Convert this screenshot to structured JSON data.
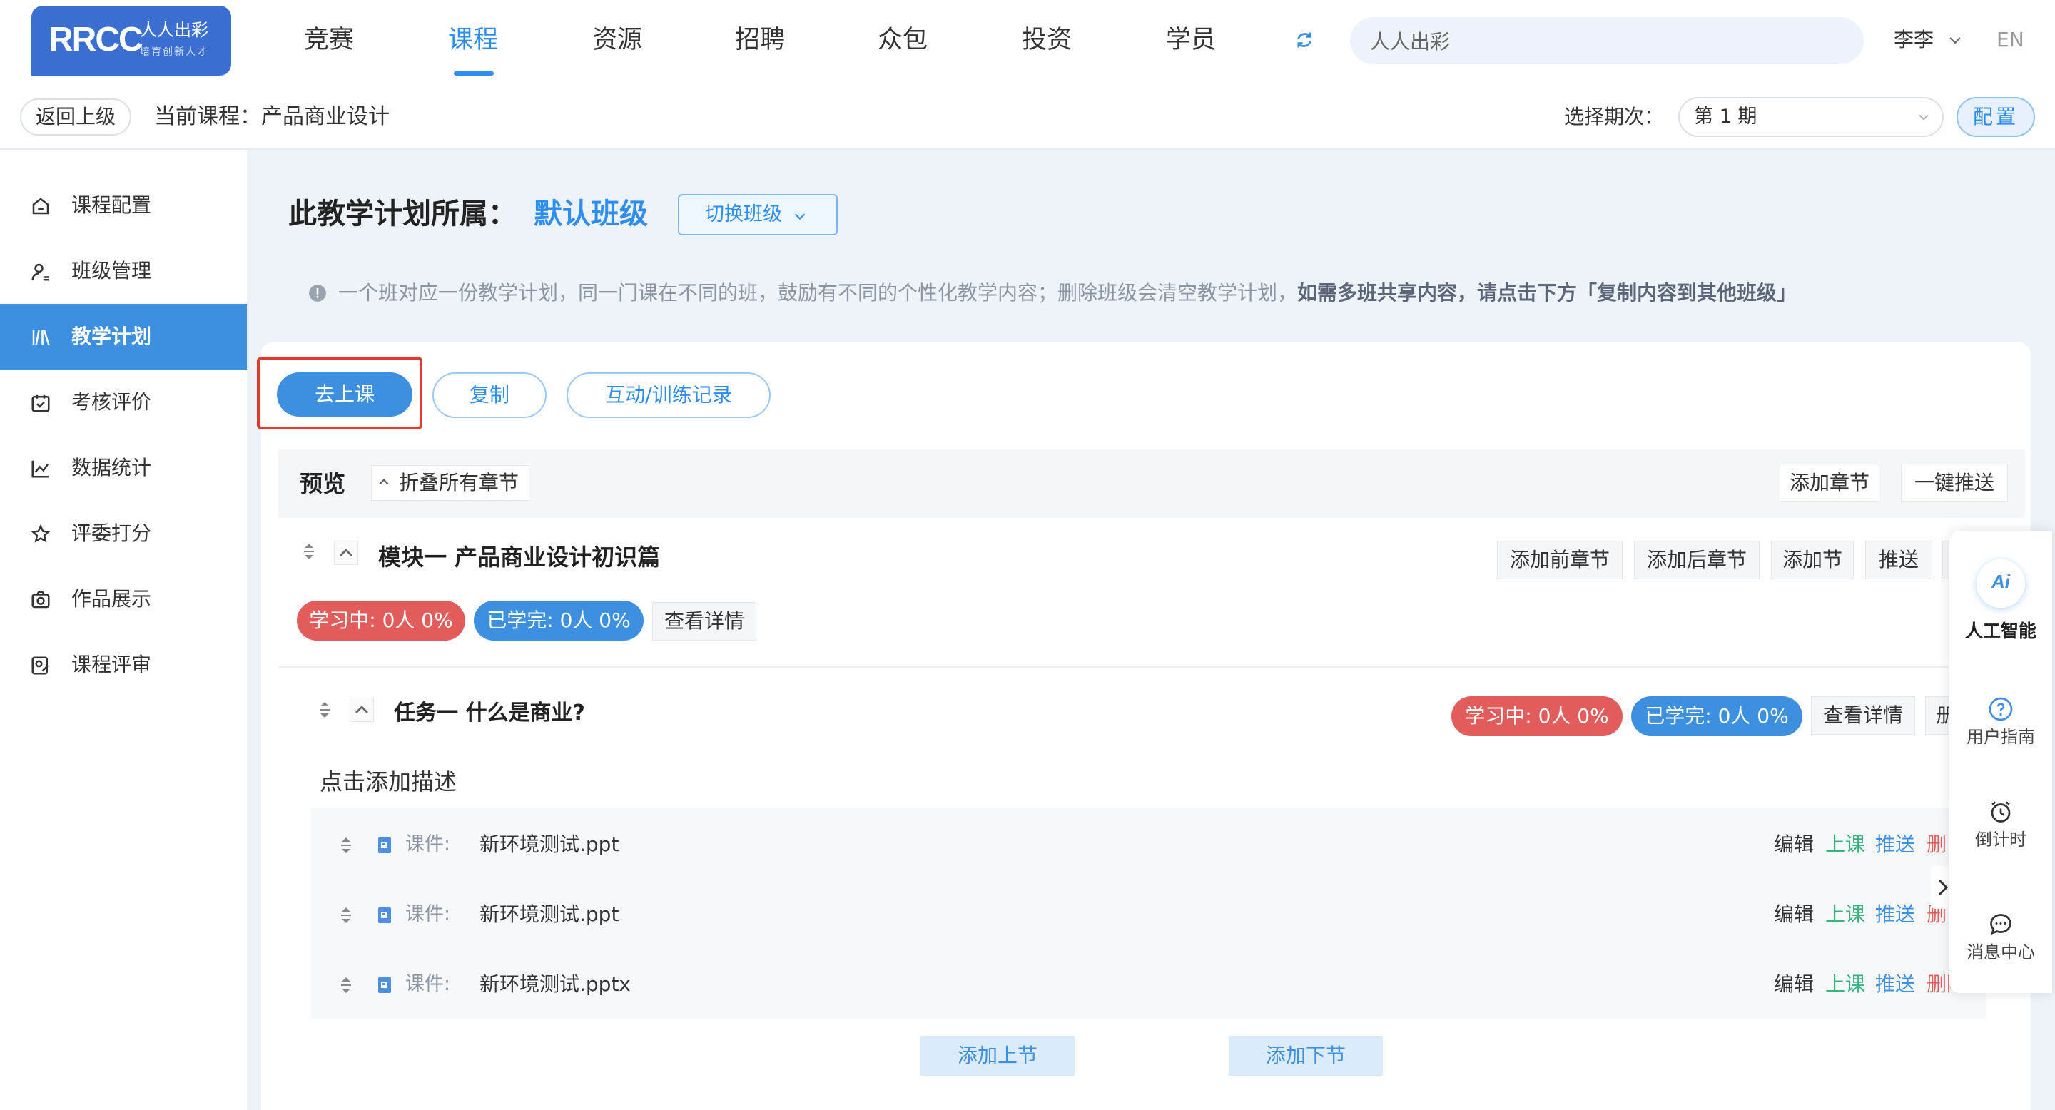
{
  "logo": {
    "brand": "RRCC",
    "name": "人人出彩",
    "slogan": "培育创新人才"
  },
  "nav": {
    "items": [
      {
        "label": "竞赛"
      },
      {
        "label": "课程"
      },
      {
        "label": "资源"
      },
      {
        "label": "招聘"
      },
      {
        "label": "众包"
      },
      {
        "label": "投资"
      },
      {
        "label": "学员"
      }
    ],
    "active": "课程",
    "search_value": "人人出彩",
    "user": "李李",
    "lang": "EN"
  },
  "subbar": {
    "back": "返回上级",
    "current_course": "当前课程：产品商业设计",
    "period_label": "选择期次：",
    "period_value": "第 1 期",
    "config": "配置"
  },
  "sidebar": {
    "items": [
      {
        "label": "课程配置",
        "icon": "home-icon"
      },
      {
        "label": "班级管理",
        "icon": "user-icon"
      },
      {
        "label": "教学计划",
        "icon": "plan-icon"
      },
      {
        "label": "考核评价",
        "icon": "calendar-check-icon"
      },
      {
        "label": "数据统计",
        "icon": "line-chart-icon"
      },
      {
        "label": "评委打分",
        "icon": "star-icon"
      },
      {
        "label": "作品展示",
        "icon": "camera-icon"
      },
      {
        "label": "课程评审",
        "icon": "review-icon"
      }
    ],
    "active": "教学计划"
  },
  "plan": {
    "title": "此教学计划所属：",
    "class_name": "默认班级",
    "switch_btn": "切换班级",
    "notice": "一个班对应一份教学计划，同一门课在不同的班，鼓励有不同的个性化教学内容；删除班级会清空教学计划，",
    "notice_bold": "如需多班共享内容，请点击下方「复制内容到其他班级」"
  },
  "actions": {
    "go_class": "去上课",
    "copy": "复制",
    "records": "互动/训练记录"
  },
  "preview": {
    "title": "预览",
    "collapse_all": "折叠所有章节",
    "add_chapter": "添加章节",
    "push_all": "一键推送"
  },
  "module": {
    "title": "模块一 产品商业设计初识篇",
    "add_before": "添加前章节",
    "add_after": "添加后章节",
    "add_section": "添加节",
    "push": "推送",
    "learning": "学习中: 0人 0%",
    "finished": "已学完: 0人 0%",
    "details": "查看详情"
  },
  "task": {
    "title": "任务一 什么是商业?",
    "learning": "学习中: 0人 0%",
    "finished": "已学完: 0人 0%",
    "details": "查看详情",
    "cut_label": "册",
    "desc": "点击添加描述"
  },
  "files": [
    {
      "kind": "课件:",
      "name": "新环境测试.ppt",
      "edit": "编辑",
      "teach": "上课",
      "push": "推送",
      "del": "删"
    },
    {
      "kind": "课件:",
      "name": "新环境测试.ppt",
      "edit": "编辑",
      "teach": "上课",
      "push": "推送",
      "del": "删"
    },
    {
      "kind": "课件:",
      "name": "新环境测试.pptx",
      "edit": "编辑",
      "teach": "上课",
      "push": "推送",
      "del": "删除"
    }
  ],
  "add_buttons": {
    "prev": "添加上节",
    "next": "添加下节"
  },
  "float_panel": {
    "ai_logo": "Ai",
    "ai": "人工智能",
    "guide": "用户指南",
    "timer": "倒计时",
    "messages": "消息中心"
  },
  "colors": {
    "primary": "#3d8fdf",
    "danger": "#e15c5a",
    "success": "#36b37e",
    "highlight": "#e23a2e"
  }
}
